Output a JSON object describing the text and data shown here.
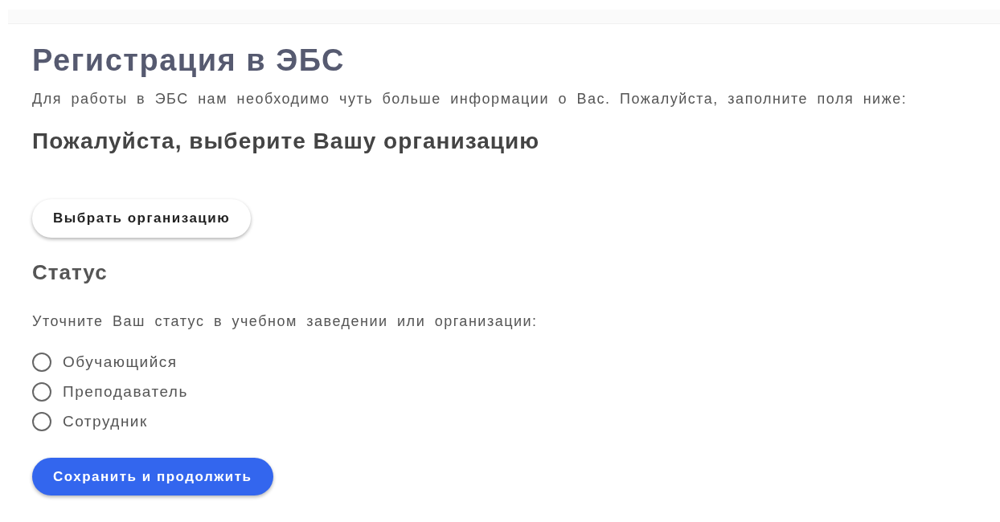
{
  "title": "Регистрация в ЭБС",
  "intro": "Для работы в ЭБС нам необходимо чуть больше информации о Вас. Пожалуйста, заполните поля ниже:",
  "organization": {
    "heading": "Пожалуйста, выберите Вашу организацию",
    "button": "Выбрать организацию"
  },
  "status": {
    "heading": "Статус",
    "prompt": "Уточните Ваш статус в учебном заведении или организации:",
    "options": [
      {
        "label": "Обучающийся",
        "selected": false
      },
      {
        "label": "Преподаватель",
        "selected": false
      },
      {
        "label": "Сотрудник",
        "selected": false
      }
    ]
  },
  "submit": "Сохранить и продолжить"
}
